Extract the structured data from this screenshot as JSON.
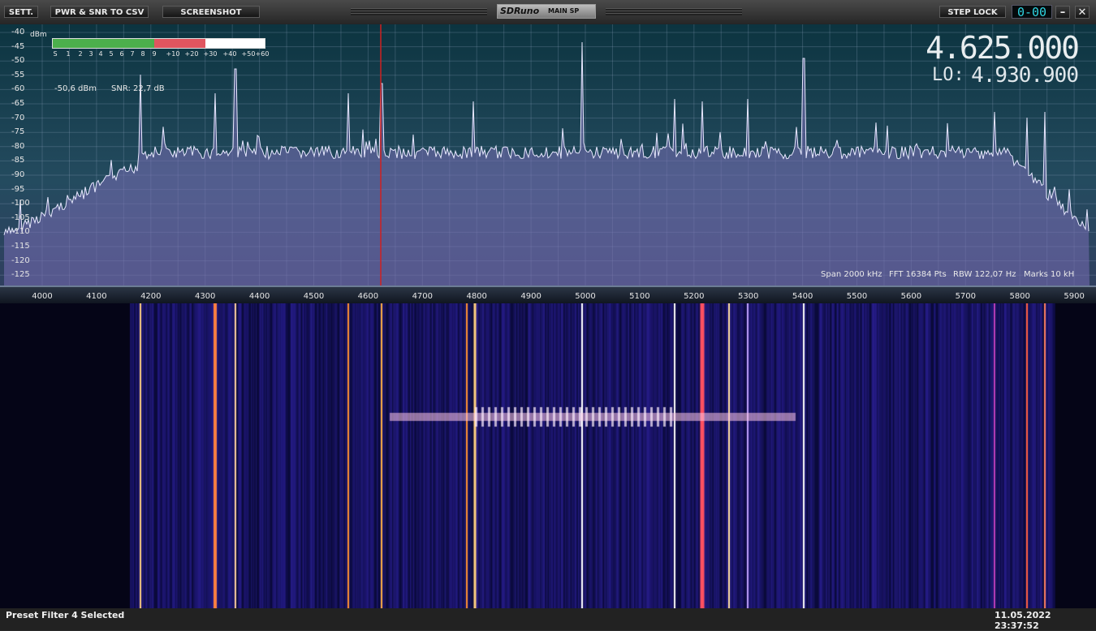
{
  "toolbar": {
    "sett": "SETT.",
    "csv": "PWR & SNR TO CSV",
    "screenshot": "SCREENSHOT",
    "steplock": "STEP LOCK",
    "clock": "0-00",
    "minimize": "–",
    "close": "✕"
  },
  "logo": {
    "brand": "SDRuno",
    "sub": "MAIN SP"
  },
  "spectrum": {
    "unit": "dBm",
    "db_labels": [
      "-40",
      "-45",
      "-50",
      "-55",
      "-60",
      "-65",
      "-70",
      "-75",
      "-80",
      "-85",
      "-90",
      "-95",
      "-100",
      "-105",
      "-110",
      "-115",
      "-120",
      "-125"
    ],
    "power": "-50,6 dBm",
    "snr": "SNR: 22,7 dB",
    "frequency": "4.625.000",
    "lo_label": "LO:",
    "lo_frequency": "4.930.900",
    "span": "Span 2000 kHz",
    "fft": "FFT 16384 Pts",
    "rbw": "RBW 122,07 Hz",
    "marks": "Marks 10 kH",
    "smeter": {
      "labels": [
        "S",
        "1",
        "2",
        "3",
        "4",
        "5",
        "6",
        "7",
        "8",
        "9",
        "+10",
        "+20",
        "+30",
        "+40",
        "+50",
        "+60"
      ],
      "green_fraction": 0.48,
      "red_fraction": 0.24,
      "green_color": "#4caf4c",
      "red_color": "#e0555f"
    }
  },
  "freq_axis": [
    "4000",
    "4100",
    "4200",
    "4300",
    "4400",
    "4500",
    "4600",
    "4700",
    "4800",
    "4900",
    "5000",
    "5100",
    "5200",
    "5300",
    "5400",
    "5500",
    "5600",
    "5700",
    "5800",
    "5900"
  ],
  "status": {
    "left": "Preset Filter 4 Selected",
    "right": "11.05.2022 23:37:52"
  }
}
